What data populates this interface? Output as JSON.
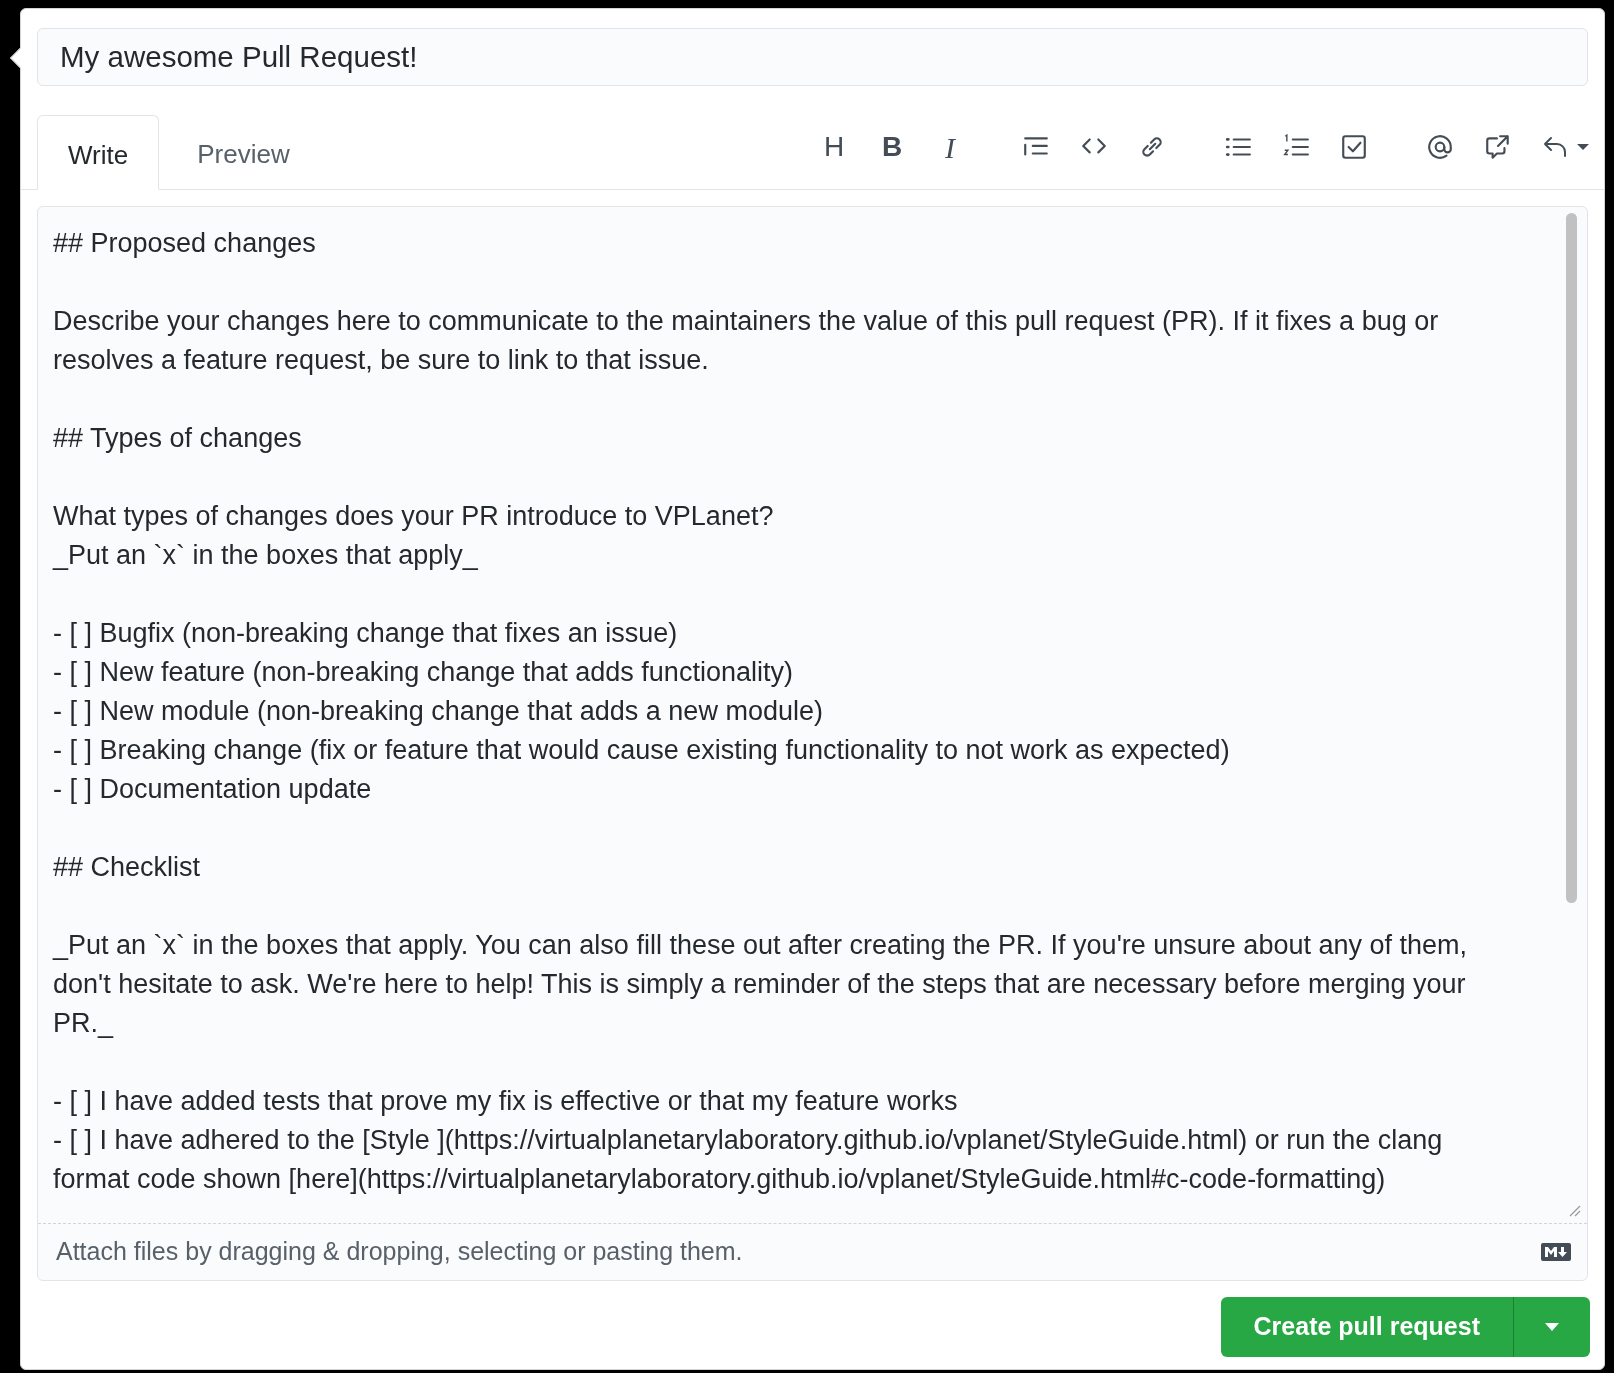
{
  "title_field": {
    "value": "My awesome Pull Request!"
  },
  "tabs": [
    {
      "label": "Write",
      "selected": true
    },
    {
      "label": "Preview",
      "selected": false
    }
  ],
  "toolbar": [
    [
      {
        "kind": "heading",
        "label": "H"
      },
      {
        "kind": "bold",
        "label": "B"
      },
      {
        "kind": "italic",
        "label": "I"
      }
    ],
    [
      {
        "kind": "quote"
      },
      {
        "kind": "code"
      },
      {
        "kind": "link"
      }
    ],
    [
      {
        "kind": "bullets"
      },
      {
        "kind": "numbers"
      },
      {
        "kind": "task"
      }
    ],
    [
      {
        "kind": "mention"
      },
      {
        "kind": "reference"
      },
      {
        "kind": "reply"
      }
    ]
  ],
  "body": [
    [
      "## Proposed changes"
    ],
    [
      "Describe your changes here to communicate to the maintainers the value of this pull request (PR). If it fixes a bug or",
      "resolves a feature request, be sure to link to that issue."
    ],
    [
      "## Types of changes"
    ],
    [
      "What types of changes does your PR introduce to VPLanet?",
      "_Put an `x` in the boxes that apply_"
    ],
    [
      "- [ ] Bugfix (non-breaking change that fixes an issue)",
      "- [ ] New feature (non-breaking change that adds functionality)",
      "- [ ] New module (non-breaking change that adds a new module)",
      "- [ ] Breaking change (fix or feature that would cause existing functionality to not work as expected)",
      "- [ ] Documentation update"
    ],
    [
      "## Checklist"
    ],
    [
      "_Put an `x` in the boxes that apply. You can also fill these out after creating the PR. If you're unsure about any of them,",
      "don't hesitate to ask. We're here to help! This is simply a reminder of the steps that are necessary before merging your",
      "PR._"
    ],
    [
      "- [ ] I have added tests that prove my fix is effective or that my feature works",
      "- [ ] I have adhered to the [Style ](https://virtualplanetarylaboratory.github.io/vplanet/StyleGuide.html) or run the clang",
      "format code shown [here](https://virtualplanetarylaboratory.github.io/vplanet/StyleGuide.html#c-code-formatting)"
    ]
  ],
  "attach_hint": "Attach files by dragging & dropping, selecting or pasting them.",
  "submit": {
    "label": "Create pull request"
  }
}
